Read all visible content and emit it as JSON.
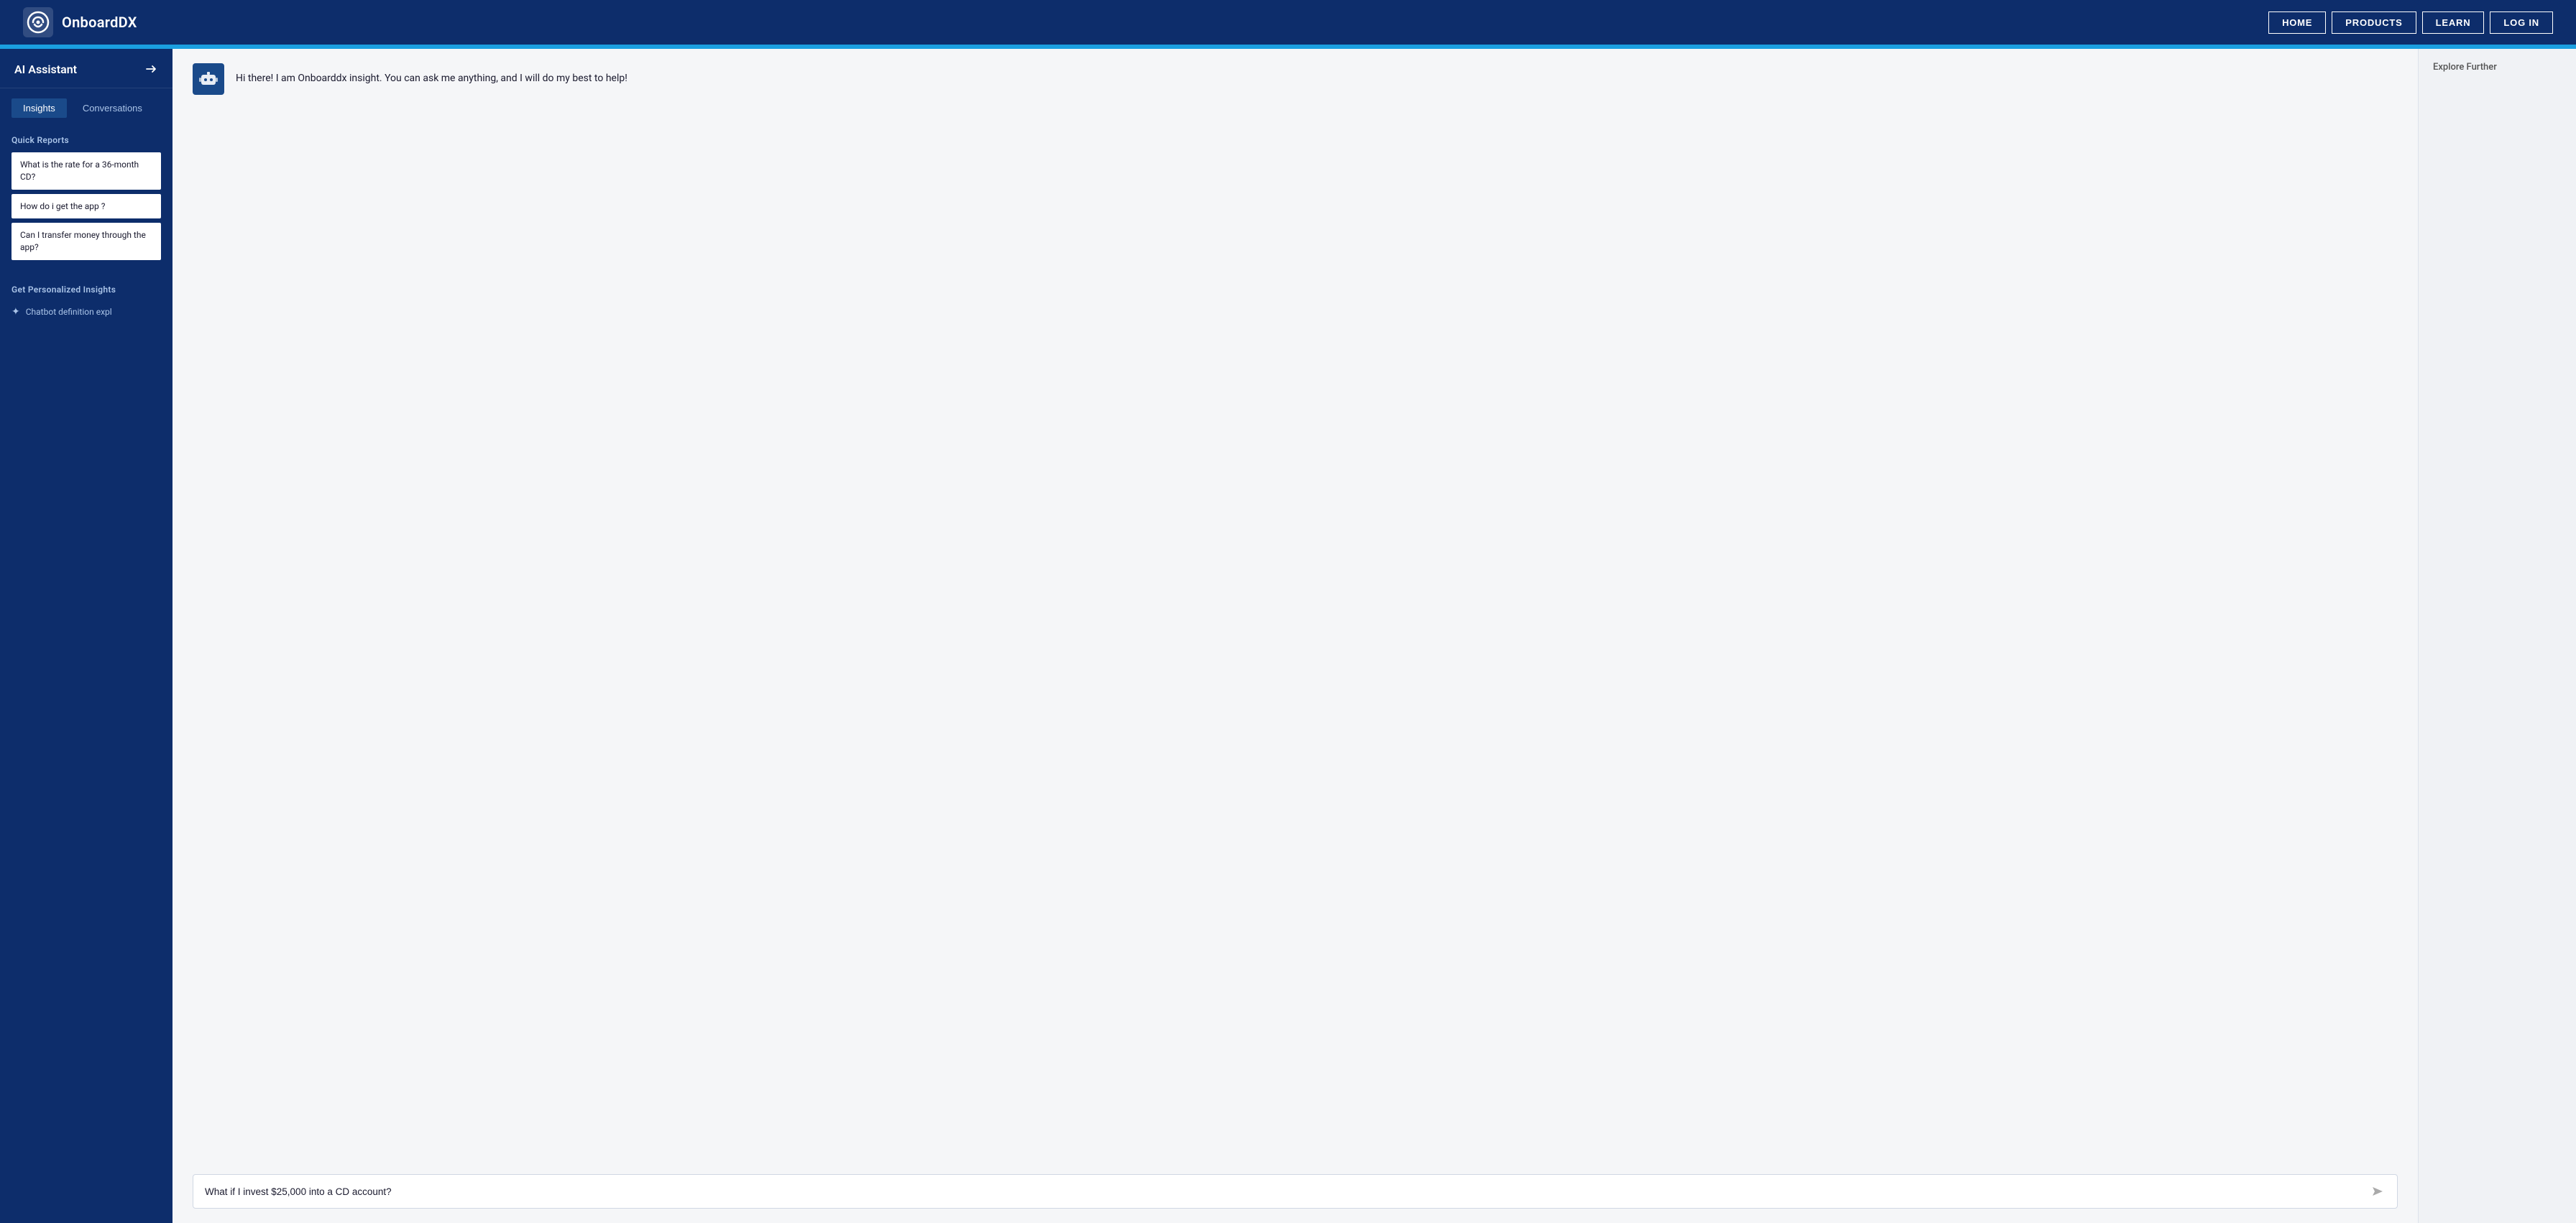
{
  "navbar": {
    "brand_name": "OnboardDX",
    "links": [
      {
        "id": "home",
        "label": "HOME"
      },
      {
        "id": "products",
        "label": "PRODUCTS"
      },
      {
        "id": "learn",
        "label": "LEARN"
      },
      {
        "id": "login",
        "label": "LOG IN"
      }
    ]
  },
  "sidebar": {
    "title": "AI Assistant",
    "tabs": [
      {
        "id": "insights",
        "label": "Insights",
        "active": true
      },
      {
        "id": "conversations",
        "label": "Conversations",
        "active": false
      }
    ],
    "quick_reports_label": "Quick Reports",
    "quick_reports": [
      {
        "id": "qr1",
        "text": "What is the rate for a 36-month CD?"
      },
      {
        "id": "qr2",
        "text": "How do i get the app ?"
      },
      {
        "id": "qr3",
        "text": "Can I transfer money through the app?"
      }
    ],
    "personalized_label": "Get Personalized Insights",
    "personalized_items": [
      {
        "id": "pi1",
        "text": "Chatbot definition expl"
      }
    ]
  },
  "chat": {
    "welcome_message": "Hi there! I am Onboarddx insight. You can ask me anything, and I will do my best to help!",
    "input_placeholder": "What if I invest $25,000 into a CD account?",
    "input_value": "What if I invest $25,000 into a CD account?"
  },
  "right_panel": {
    "explore_label": "Explore Further"
  },
  "colors": {
    "navbar_bg": "#0d2d6b",
    "accent_bar": "#1a9fe0",
    "sidebar_bg": "#0d2d6b",
    "active_tab_bg": "#1a4a8a"
  }
}
